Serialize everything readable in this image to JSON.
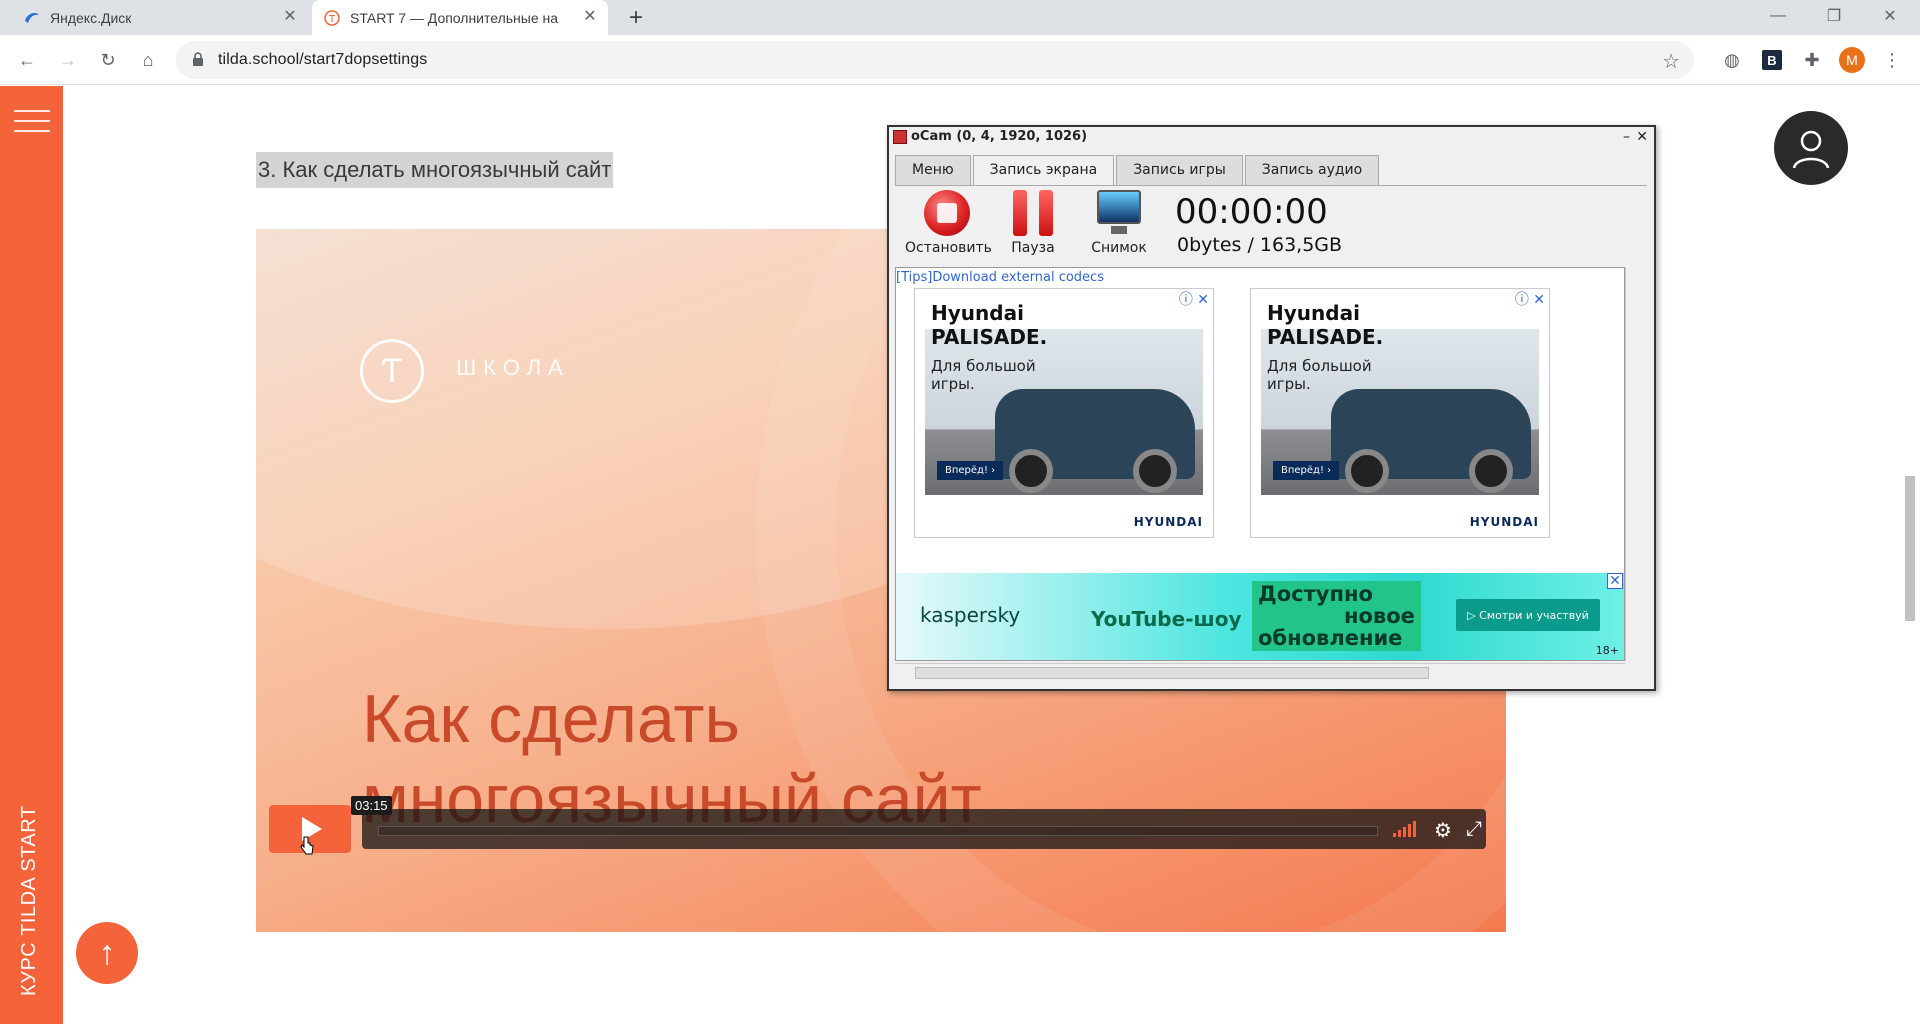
{
  "browser": {
    "tabs": [
      {
        "title": "Яндекс.Диск",
        "icon": "yandex-disk-icon",
        "active": false
      },
      {
        "title": "START 7 — Дополнительные на",
        "icon": "tilda-icon",
        "active": true
      }
    ],
    "new_tab": "+",
    "url": "tilda.school/start7dopsettings",
    "profile_initial": "M"
  },
  "page": {
    "rail_label": "КУРС TILDA START",
    "section_title": "3. Как сделать многоязычный сайт",
    "video": {
      "logo_glyph": "Ƭ",
      "school_label": "ШКОЛА",
      "title_line1": "Как сделать",
      "title_line2": "многоязычный сайт",
      "time": "03:15"
    }
  },
  "ocam": {
    "title": "oCam (0, 4, 1920, 1026)",
    "tabs": [
      "Меню",
      "Запись экрана",
      "Запись игры",
      "Запись аудио"
    ],
    "active_tab": "Запись экрана",
    "tools": {
      "stop": "Остановить",
      "pause": "Пауза",
      "snapshot": "Снимок"
    },
    "timer": "00:00:00",
    "bytes": "0bytes / 163,5GB",
    "tips": "[Tips]Download external codecs",
    "ads": [
      {
        "headline1": "Hyundai",
        "headline2": "PALISADE.",
        "sub1": "Для большой",
        "sub2": "игры.",
        "cta": "Вперёд! ›",
        "brand": "HYUNDAI"
      },
      {
        "headline1": "Hyundai",
        "headline2": "PALISADE.",
        "sub1": "Для большой",
        "sub2": "игры.",
        "cta": "Вперёд! ›",
        "brand": "HYUNDAI"
      }
    ],
    "banner": {
      "brand": "kaspersky",
      "show": "YouTube-шоу",
      "line1": "Доступно",
      "line2": "новое",
      "line3": "обновление",
      "button": "▷ Смотри и участвуй",
      "age": "18+"
    }
  },
  "colors": {
    "accent": "#f4633a",
    "rail": "#f4633a"
  }
}
